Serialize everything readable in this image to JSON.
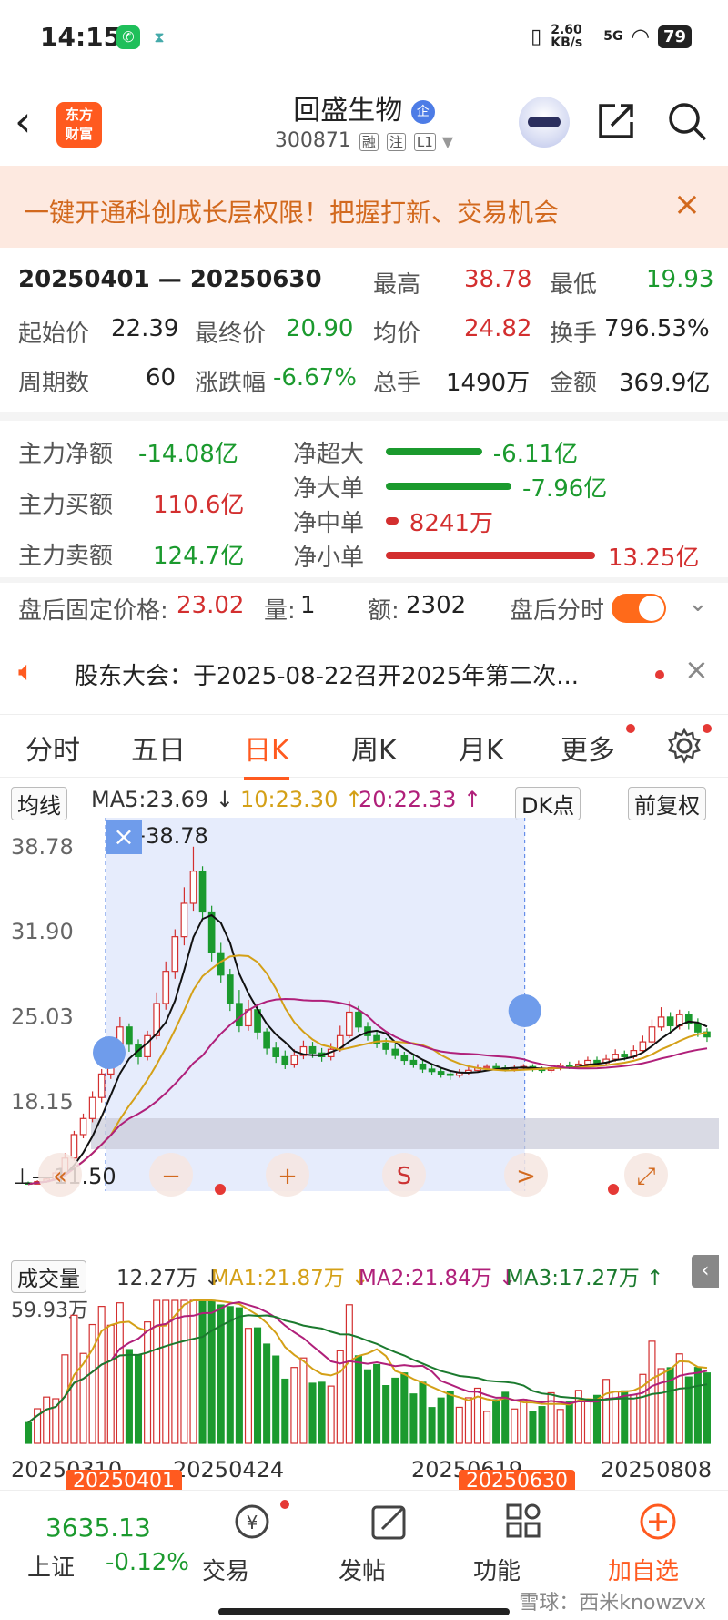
{
  "status_bar": {
    "time": "14:15",
    "net_speed": "2.60 KB/s",
    "network": "5G",
    "battery": "79"
  },
  "header": {
    "stock_name": "回盛生物",
    "badge": "企",
    "stock_code": "300871",
    "tags": [
      "融",
      "注",
      "L1"
    ],
    "logo_line1": "东方",
    "logo_line2": "财富"
  },
  "banner": {
    "text": "一键开通科创成长层权限！把握打新、交易机会",
    "close": "×"
  },
  "summary": {
    "period": "20250401 — 20250630",
    "high_label": "最高",
    "high": "38.78",
    "low_label": "最低",
    "low": "19.93",
    "open_label": "起始价",
    "open": "22.39",
    "close_label": "最终价",
    "close": "20.90",
    "avg_label": "均价",
    "avg": "24.82",
    "turnover_label": "换手",
    "turnover": "796.53%",
    "periods_label": "周期数",
    "periods": "60",
    "change_label": "涨跌幅",
    "change": "-6.67%",
    "volume_label": "总手",
    "volume": "1490万",
    "amount_label": "金额",
    "amount": "369.9亿"
  },
  "capital_flow": {
    "main_net_label": "主力净额",
    "main_net": "-14.08亿",
    "main_buy_label": "主力买额",
    "main_buy": "110.6亿",
    "main_sell_label": "主力卖额",
    "main_sell": "124.7亿",
    "items": [
      {
        "label": "净超大",
        "value": "-6.11亿",
        "ratio": 0.46,
        "color": "#1b9a2e"
      },
      {
        "label": "净大单",
        "value": "-7.96亿",
        "ratio": 0.6,
        "color": "#1b9a2e"
      },
      {
        "label": "净中单",
        "value": "8241万",
        "ratio": 0.06,
        "color": "#d32f2f"
      },
      {
        "label": "净小单",
        "value": "13.25亿",
        "ratio": 1.0,
        "color": "#d32f2f"
      }
    ]
  },
  "after_hours": {
    "price_label": "盘后固定价格:",
    "price": "23.02",
    "qty_label": "量:",
    "qty": "1",
    "amt_label": "额:",
    "amt": "2302",
    "toggle_label": "盘后分时"
  },
  "notice": {
    "text": "股东大会：于2025-08-22召开2025年第二次..."
  },
  "tabs": [
    "分时",
    "五日",
    "日K",
    "周K",
    "月K",
    "更多"
  ],
  "active_tab": "日K",
  "ma_bar": {
    "selector": "均线",
    "ma5": "MA5:23.69 ↓",
    "ma10": "10:23.30 ↑",
    "ma20": "20:22.33 ↑",
    "dk": "DK点",
    "fq": "前复权"
  },
  "chart_data": {
    "type": "candlestick",
    "y_ticks": [
      "38.78",
      "31.90",
      "25.03",
      "18.15"
    ],
    "ylim": [
      11.3,
      39.5
    ],
    "high_label": "38.78",
    "low_label": "11.50",
    "high_marker": "×",
    "selection": [
      "20250401",
      "20250630"
    ],
    "candles": [
      [
        11.6,
        11.5,
        11.7,
        11.5
      ],
      [
        11.5,
        11.7,
        11.8,
        11.5
      ],
      [
        11.7,
        11.9,
        12.0,
        11.6
      ],
      [
        11.9,
        12.4,
        12.6,
        11.8
      ],
      [
        12.4,
        13.6,
        14.0,
        12.3
      ],
      [
        13.6,
        15.5,
        15.8,
        13.4
      ],
      [
        15.5,
        16.8,
        17.2,
        15.2
      ],
      [
        16.8,
        18.5,
        19.0,
        16.5
      ],
      [
        18.5,
        20.4,
        20.8,
        18.1
      ],
      [
        20.4,
        22.3,
        22.6,
        20.0
      ],
      [
        22.3,
        24.2,
        25.0,
        21.8
      ],
      [
        24.2,
        22.8,
        24.5,
        22.2
      ],
      [
        22.8,
        21.8,
        23.2,
        21.2
      ],
      [
        21.8,
        23.5,
        23.9,
        21.5
      ],
      [
        23.5,
        26.1,
        27.0,
        23.2
      ],
      [
        26.1,
        28.7,
        29.5,
        25.6
      ],
      [
        28.7,
        31.5,
        32.1,
        28.1
      ],
      [
        31.5,
        34.2,
        35.5,
        30.8
      ],
      [
        34.2,
        36.8,
        38.78,
        33.6
      ],
      [
        36.8,
        33.5,
        37.2,
        32.9
      ],
      [
        33.5,
        30.2,
        34.0,
        29.5
      ],
      [
        30.2,
        28.4,
        31.0,
        27.8
      ],
      [
        28.4,
        26.1,
        28.9,
        25.5
      ],
      [
        26.1,
        24.3,
        27.2,
        23.8
      ],
      [
        24.3,
        25.6,
        26.4,
        23.9
      ],
      [
        25.6,
        23.8,
        26.0,
        23.2
      ],
      [
        23.8,
        22.5,
        24.1,
        22.0
      ],
      [
        22.5,
        21.8,
        23.0,
        21.3
      ],
      [
        21.8,
        21.2,
        22.3,
        20.8
      ],
      [
        21.2,
        21.9,
        22.4,
        20.9
      ],
      [
        21.9,
        22.6,
        23.1,
        21.6
      ],
      [
        22.6,
        22.1,
        23.0,
        21.7
      ],
      [
        22.1,
        21.8,
        22.5,
        21.4
      ],
      [
        21.8,
        22.4,
        22.9,
        21.5
      ],
      [
        22.4,
        23.5,
        24.3,
        22.2
      ],
      [
        23.5,
        25.4,
        26.3,
        23.3
      ],
      [
        25.4,
        24.2,
        25.9,
        23.8
      ],
      [
        24.2,
        23.5,
        24.6,
        23.1
      ],
      [
        23.5,
        22.9,
        23.9,
        22.5
      ],
      [
        22.9,
        22.4,
        23.3,
        22.0
      ],
      [
        22.4,
        21.9,
        22.8,
        21.6
      ],
      [
        21.9,
        21.5,
        22.2,
        21.1
      ],
      [
        21.5,
        21.2,
        21.9,
        20.9
      ],
      [
        21.2,
        20.8,
        21.5,
        20.5
      ],
      [
        20.8,
        20.6,
        21.1,
        20.3
      ],
      [
        20.6,
        20.4,
        20.9,
        20.1
      ],
      [
        20.4,
        20.3,
        20.7,
        19.93
      ],
      [
        20.3,
        20.5,
        20.8,
        20.1
      ],
      [
        20.5,
        20.7,
        21.0,
        20.3
      ],
      [
        20.7,
        20.9,
        21.2,
        20.5
      ]
    ],
    "after_candles": [
      [
        20.9,
        21.0,
        21.2,
        20.7
      ],
      [
        21.0,
        20.9,
        21.3,
        20.7
      ],
      [
        20.9,
        20.8,
        21.1,
        20.6
      ],
      [
        20.8,
        20.9,
        21.1,
        20.6
      ],
      [
        20.9,
        21.0,
        21.2,
        20.7
      ],
      [
        21.0,
        20.8,
        21.2,
        20.6
      ],
      [
        20.8,
        20.7,
        21.0,
        20.5
      ],
      [
        20.7,
        20.9,
        21.1,
        20.5
      ],
      [
        20.9,
        21.1,
        21.3,
        20.7
      ],
      [
        21.1,
        21.0,
        21.4,
        20.8
      ],
      [
        21.0,
        21.2,
        21.5,
        20.9
      ],
      [
        21.2,
        21.5,
        21.8,
        21.0
      ],
      [
        21.5,
        21.3,
        21.8,
        21.1
      ],
      [
        21.3,
        21.6,
        22.0,
        21.1
      ],
      [
        21.6,
        22.0,
        22.4,
        21.4
      ],
      [
        22.0,
        21.8,
        22.3,
        21.5
      ],
      [
        21.8,
        22.3,
        22.7,
        21.6
      ],
      [
        22.3,
        23.0,
        23.5,
        22.1
      ],
      [
        23.0,
        24.2,
        24.8,
        22.8
      ],
      [
        24.2,
        25.0,
        25.8,
        23.9
      ],
      [
        25.0,
        24.3,
        25.4,
        23.8
      ],
      [
        24.3,
        25.2,
        25.6,
        24.0
      ],
      [
        25.2,
        24.5,
        25.5,
        24.0
      ],
      [
        24.5,
        23.8,
        24.9,
        23.4
      ],
      [
        23.8,
        23.4,
        24.1,
        23.0
      ]
    ]
  },
  "chart_buttons": [
    "−",
    "+",
    "S",
    ">"
  ],
  "volume_bar": {
    "selector": "成交量",
    "vol": "12.27万 ↓",
    "ma1": "MA1:21.87万 ↓",
    "ma2": "MA2:21.84万 ↓",
    "ma3": "MA3:17.27万 ↑"
  },
  "volume_data": {
    "max_label": "59.93万",
    "max": 59.93
  },
  "x_axis": {
    "labels": [
      "20250310",
      "20250424",
      "20250619",
      "20250808"
    ],
    "range_start": "20250401",
    "range_end": "20250630"
  },
  "bottom_bar": {
    "index_value": "3635.13",
    "index_name": "上证",
    "index_change": "-0.12%",
    "nav": [
      {
        "label": "交易"
      },
      {
        "label": "发帖"
      },
      {
        "label": "功能"
      },
      {
        "label": "加自选"
      }
    ]
  },
  "watermark": "雪球：西米knowzvx",
  "colors": {
    "accent": "#ff5a1f",
    "up": "#d32f2f",
    "down": "#1b9a2e",
    "selection": "#dde6fb"
  }
}
